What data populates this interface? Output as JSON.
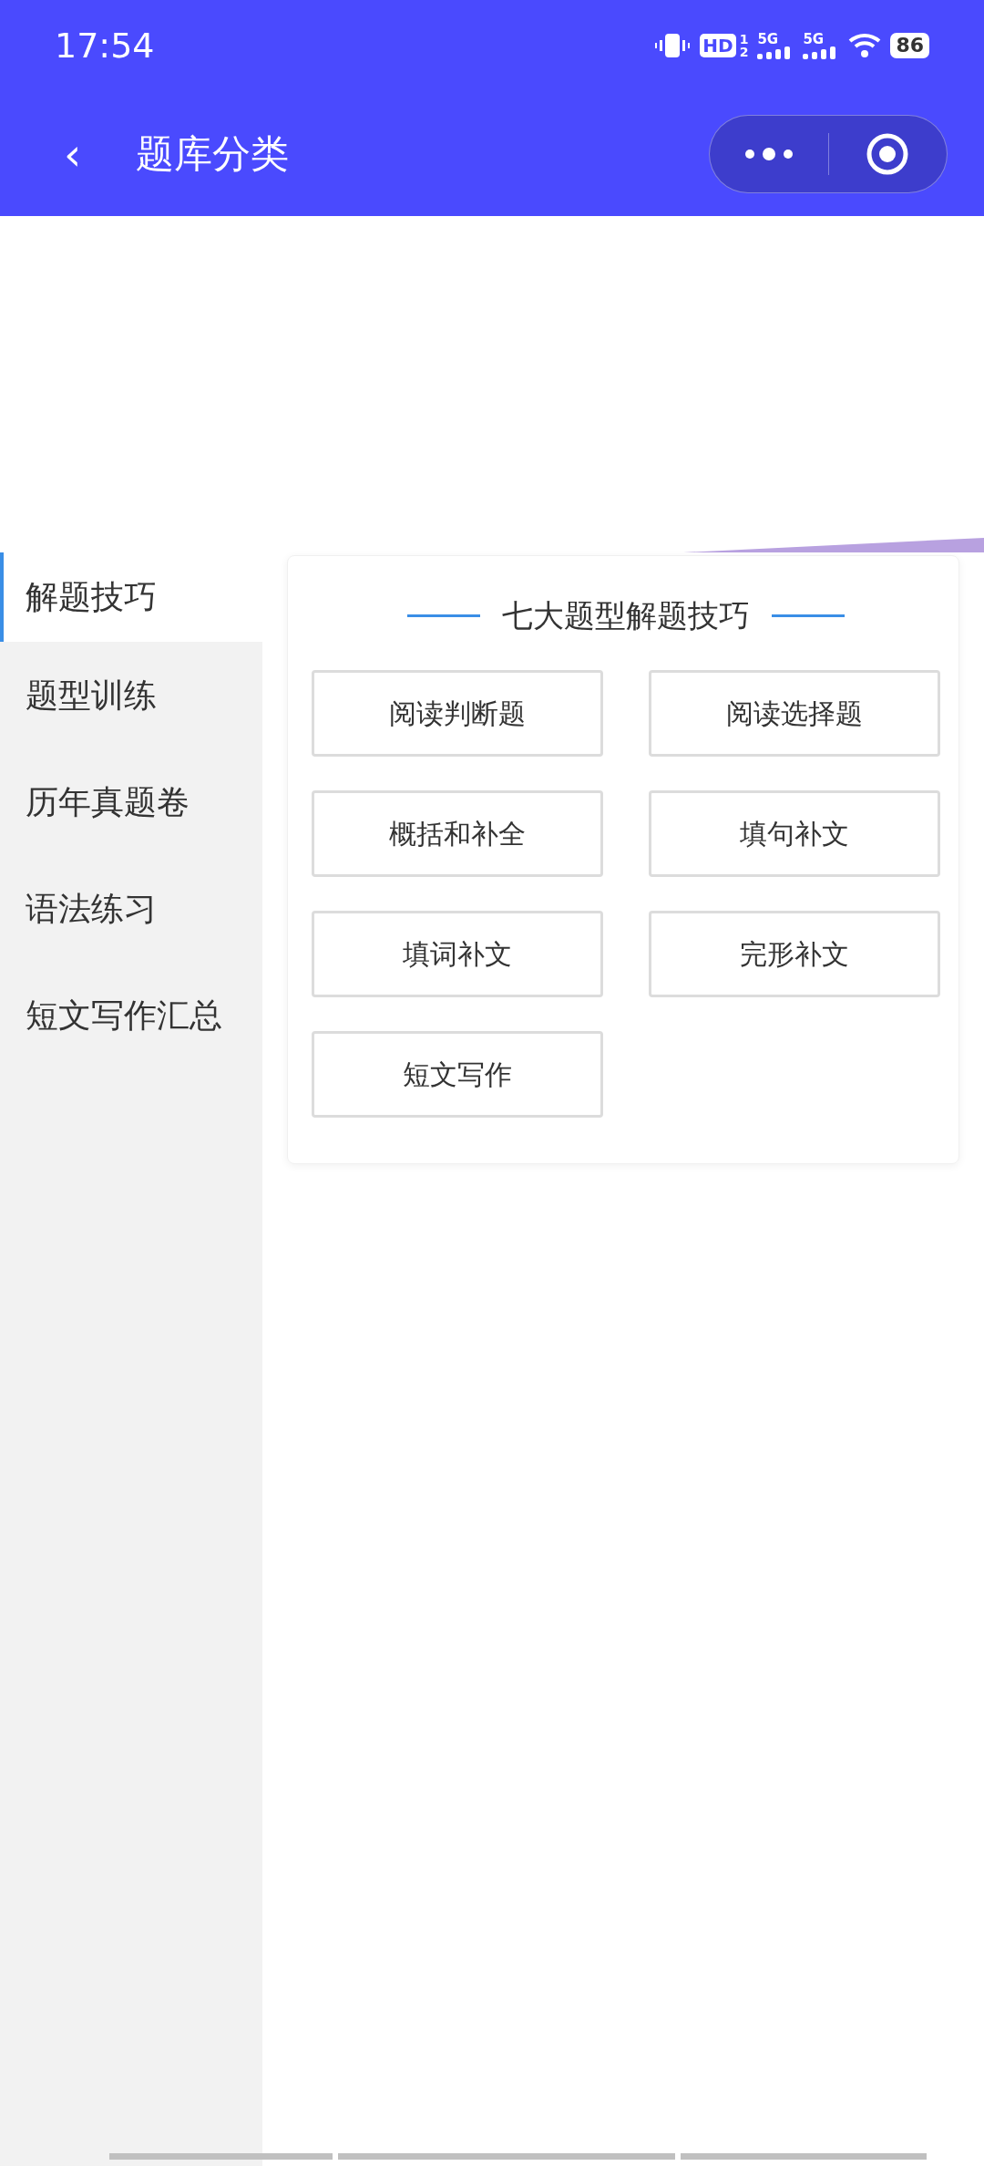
{
  "status_bar": {
    "time": "17:54",
    "hd": {
      "label": "HD",
      "sup": "1",
      "sub": "2"
    },
    "networks": [
      "5G",
      "5G"
    ],
    "battery": "86"
  },
  "nav_bar": {
    "back": "‹",
    "title": "题库分类"
  },
  "sidebar": {
    "items": [
      {
        "label": "解题技巧",
        "selected": true
      },
      {
        "label": "题型训练",
        "selected": false
      },
      {
        "label": "历年真题卷",
        "selected": false
      },
      {
        "label": "语法练习",
        "selected": false
      },
      {
        "label": "短文写作汇总",
        "selected": false
      }
    ]
  },
  "card": {
    "title": "七大题型解题技巧",
    "buttons": [
      "阅读判断题",
      "阅读选择题",
      "概括和补全",
      "填句补文",
      "填词补文",
      "完形补文",
      "短文写作"
    ]
  }
}
